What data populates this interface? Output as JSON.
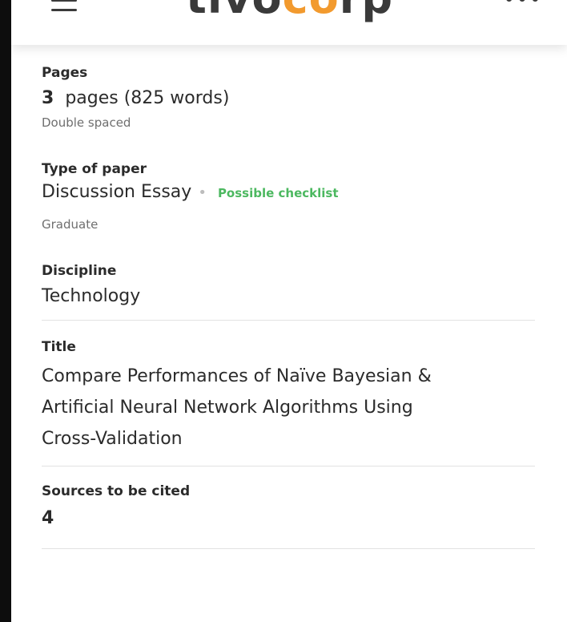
{
  "header": {
    "logo_main": "tivo",
    "logo_accent": "co",
    "logo_tail": "rp",
    "menu_icon": "hamburger-icon",
    "more_icon": "more-dots-icon"
  },
  "pages": {
    "label": "Pages",
    "count": "3",
    "value_rest": "pages (825 words)",
    "spacing": "Double spaced"
  },
  "type_of_paper": {
    "label": "Type of paper",
    "value": "Discussion Essay",
    "badge": "Possible checklist",
    "level": "Graduate"
  },
  "discipline": {
    "label": "Discipline",
    "value": "Technology"
  },
  "title": {
    "label": "Title",
    "line1": "Compare Performances of Naïve Bayesian &",
    "line2": "Artificial Neural Network Algorithms Using",
    "line3": "Cross-Validation"
  },
  "sources": {
    "label": "Sources to be cited",
    "value": "4"
  },
  "colors": {
    "badge_green": "#4cb860",
    "logo_accent": "#f29a2e"
  }
}
